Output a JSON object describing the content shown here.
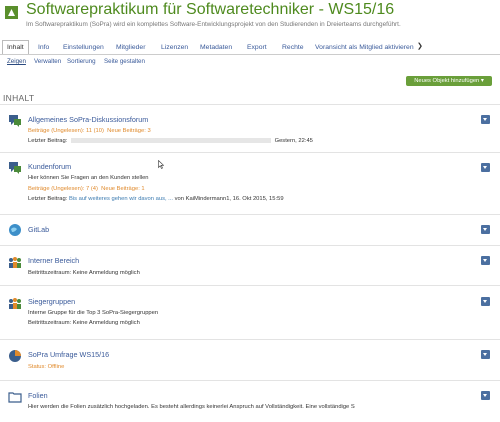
{
  "header": {
    "title": "Softwarepraktikum für Softwaretechniker - WS15/16",
    "subtitle": "Im Softwarepraktikum (SoPra) wird ein komplettes Software-Entwicklungsprojekt von den Studierenden in Dreierteams durchgeführt."
  },
  "tabs": [
    "Inhalt",
    "Info",
    "Einstellungen",
    "Mitglieder",
    "Lizenzen",
    "Metadaten",
    "Export",
    "Rechte",
    "Voransicht als Mitglied aktivieren"
  ],
  "subtabs": [
    "Zeigen",
    "Verwalten",
    "Sortierung",
    "Seite gestalten"
  ],
  "add_button": "Neues Objekt hinzufügen ▾",
  "section_title": "INHALT",
  "items": [
    {
      "title": "Allgemeines SoPra-Diskussionsforum",
      "icon": "forum-icon",
      "stats_unread": "Beiträge (Ungelesen): 11 (10)",
      "stats_new": "Neue Beiträge: 3",
      "last_label": "Letzter Beitrag:",
      "last_tail": "Gestern, 22:45"
    },
    {
      "title": "Kundenforum",
      "icon": "forum-icon",
      "description": "Hier können Sie Fragen an den Kunden stellen",
      "stats_unread": "Beiträge (Ungelesen): 7 (4)",
      "stats_new": "Neue Beiträge: 1",
      "last_label": "Letzter Beitrag:",
      "last_link": "Bis auf weiteres gehen wir davon aus, ...",
      "last_tail": "von KaiMindermann1, 16. Okt 2015, 15:59"
    },
    {
      "title": "GitLab",
      "icon": "weblink-icon"
    },
    {
      "title": "Interner Bereich",
      "icon": "group-icon",
      "period": "Beitrittszeitraum: Keine Anmeldung möglich"
    },
    {
      "title": "Siegergruppen",
      "icon": "group-icon",
      "description": "Interne Gruppe für die Top 3 SoPra-Siegergruppen",
      "period": "Beitrittszeitraum: Keine Anmeldung möglich"
    },
    {
      "title": "SoPra Umfrage WS15/16",
      "icon": "survey-icon",
      "status": "Status: Offline"
    },
    {
      "title": "Folien",
      "icon": "folder-icon",
      "description": "Hier werden die Folien zusätzlich hochgeladen. Es besteht allerdings keinerlei Anspruch auf Vollständigkeit. Eine vollständige S"
    }
  ],
  "colors": {
    "accent_green": "#6a9f3a",
    "title_green": "#4e8a1e",
    "link_blue": "#3a5a9a",
    "stats_orange": "#e08a2c",
    "menu_blue": "#4b6fa0"
  }
}
